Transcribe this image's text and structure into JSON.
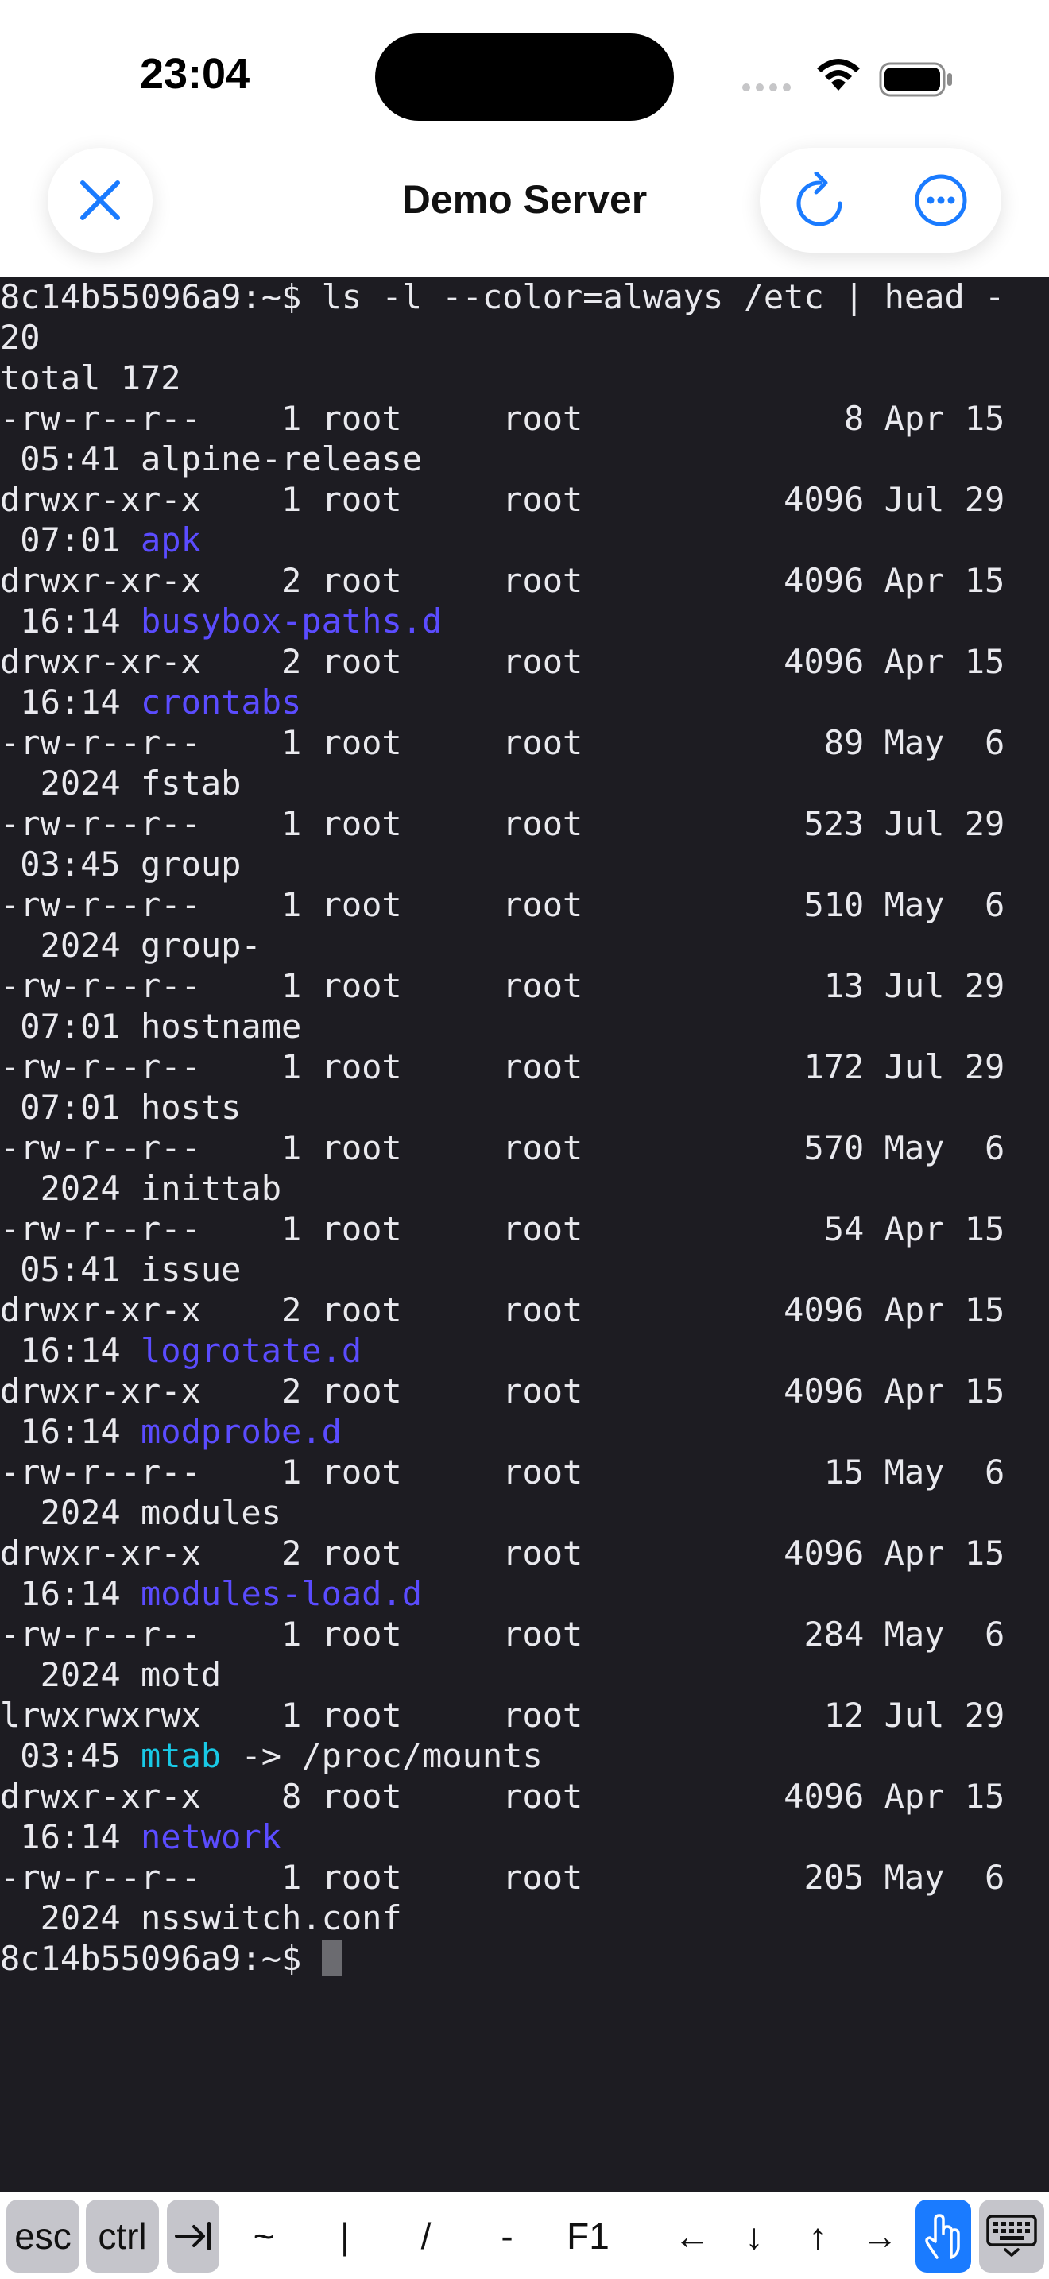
{
  "status": {
    "time": "23:04"
  },
  "header": {
    "title": "Demo Server"
  },
  "icons": {
    "close": "close-icon",
    "refresh": "refresh-icon",
    "more": "more-icon",
    "wifi": "wifi-icon",
    "battery": "battery-icon",
    "signal": "signal-icon"
  },
  "colors": {
    "accent": "#1a7bff",
    "dir": "#5b4cff",
    "link": "#19c9e6",
    "terminal_bg": "#1d1c22",
    "terminal_fg": "#e9e9ee"
  },
  "terminal": {
    "lines": [
      [
        {
          "t": "8c14b55096a9:~$ ls -l --color=always /etc | head -"
        }
      ],
      [
        {
          "t": "20"
        }
      ],
      [
        {
          "t": "total 172"
        }
      ],
      [
        {
          "t": "-rw-r--r--    1 root     root             8 Apr 15"
        }
      ],
      [
        {
          "t": " 05:41 alpine-release"
        }
      ],
      [
        {
          "t": "drwxr-xr-x    1 root     root          4096 Jul 29"
        }
      ],
      [
        {
          "t": " 07:01 "
        },
        {
          "t": "apk",
          "c": "dir"
        }
      ],
      [
        {
          "t": "drwxr-xr-x    2 root     root          4096 Apr 15"
        }
      ],
      [
        {
          "t": " 16:14 "
        },
        {
          "t": "busybox-paths.d",
          "c": "dir"
        }
      ],
      [
        {
          "t": "drwxr-xr-x    2 root     root          4096 Apr 15"
        }
      ],
      [
        {
          "t": " 16:14 "
        },
        {
          "t": "crontabs",
          "c": "dir"
        }
      ],
      [
        {
          "t": "-rw-r--r--    1 root     root            89 May  6"
        }
      ],
      [
        {
          "t": "  2024 fstab"
        }
      ],
      [
        {
          "t": "-rw-r--r--    1 root     root           523 Jul 29"
        }
      ],
      [
        {
          "t": " 03:45 group"
        }
      ],
      [
        {
          "t": "-rw-r--r--    1 root     root           510 May  6"
        }
      ],
      [
        {
          "t": "  2024 group-"
        }
      ],
      [
        {
          "t": "-rw-r--r--    1 root     root            13 Jul 29"
        }
      ],
      [
        {
          "t": " 07:01 hostname"
        }
      ],
      [
        {
          "t": "-rw-r--r--    1 root     root           172 Jul 29"
        }
      ],
      [
        {
          "t": " 07:01 hosts"
        }
      ],
      [
        {
          "t": "-rw-r--r--    1 root     root           570 May  6"
        }
      ],
      [
        {
          "t": "  2024 inittab"
        }
      ],
      [
        {
          "t": "-rw-r--r--    1 root     root            54 Apr 15"
        }
      ],
      [
        {
          "t": " 05:41 issue"
        }
      ],
      [
        {
          "t": "drwxr-xr-x    2 root     root          4096 Apr 15"
        }
      ],
      [
        {
          "t": " 16:14 "
        },
        {
          "t": "logrotate.d",
          "c": "dir"
        }
      ],
      [
        {
          "t": "drwxr-xr-x    2 root     root          4096 Apr 15"
        }
      ],
      [
        {
          "t": " 16:14 "
        },
        {
          "t": "modprobe.d",
          "c": "dir"
        }
      ],
      [
        {
          "t": "-rw-r--r--    1 root     root            15 May  6"
        }
      ],
      [
        {
          "t": "  2024 modules"
        }
      ],
      [
        {
          "t": "drwxr-xr-x    2 root     root          4096 Apr 15"
        }
      ],
      [
        {
          "t": " 16:14 "
        },
        {
          "t": "modules-load.d",
          "c": "dir"
        }
      ],
      [
        {
          "t": "-rw-r--r--    1 root     root           284 May  6"
        }
      ],
      [
        {
          "t": "  2024 motd"
        }
      ],
      [
        {
          "t": "lrwxrwxrwx    1 root     root            12 Jul 29"
        }
      ],
      [
        {
          "t": " 03:45 "
        },
        {
          "t": "mtab",
          "c": "link"
        },
        {
          "t": " -> /proc/mounts"
        }
      ],
      [
        {
          "t": "drwxr-xr-x    8 root     root          4096 Apr 15"
        }
      ],
      [
        {
          "t": " 16:14 "
        },
        {
          "t": "network",
          "c": "dir"
        }
      ],
      [
        {
          "t": "-rw-r--r--    1 root     root           205 May  6"
        }
      ],
      [
        {
          "t": "  2024 nsswitch.conf"
        }
      ]
    ],
    "prompt": "8c14b55096a9:~$ "
  },
  "keybar": {
    "esc": "esc",
    "ctrl": "ctrl",
    "tab": "→|",
    "tilde": "~",
    "pipe": "|",
    "slash": "/",
    "dash": "-",
    "f1": "F1",
    "left": "←",
    "down": "↓",
    "up": "↑",
    "right": "→"
  }
}
